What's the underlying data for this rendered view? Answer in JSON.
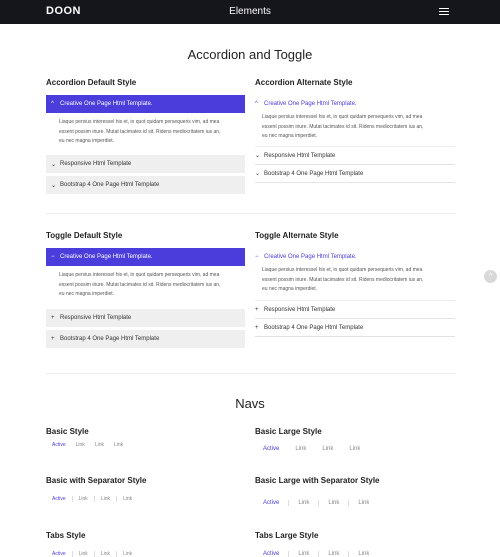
{
  "topbar": {
    "logo": "DOON",
    "title": "Elements"
  },
  "accordion_section": {
    "title": "Accordion and Toggle",
    "default": {
      "title": "Accordion Default Style",
      "items": [
        {
          "label": "Creative One Page Html Template.",
          "icon": "^"
        },
        {
          "label": "Responsive Html Template",
          "icon": "⌄"
        },
        {
          "label": "Bootstrap 4 One Page Html Template",
          "icon": "⌄"
        }
      ]
    },
    "alternate": {
      "title": "Accordion Alternate Style",
      "items": [
        {
          "label": "Creative One Page Html Template.",
          "icon": "^"
        },
        {
          "label": "Responsive Html Template",
          "icon": "⌄"
        },
        {
          "label": "Bootstrap 4 One Page Html Template",
          "icon": "⌄"
        }
      ]
    },
    "body_lines": [
      "Liaque persius interessel his et, in quot quidam persequeris vim, ad mea",
      "essent possim iriure. Mutat tacimates id sit. Ridens mediocritatem ius an,",
      "eu nec magna imperdiet."
    ]
  },
  "toggle_section": {
    "default": {
      "title": "Toggle Default Style",
      "items": [
        {
          "label": "Creative One Page Html Template.",
          "icon": "−"
        },
        {
          "label": "Responsive Html Template",
          "icon": "+"
        },
        {
          "label": "Bootstrap 4 One Page Html Template",
          "icon": "+"
        }
      ]
    },
    "alternate": {
      "title": "Toggle Alternate Style",
      "items": [
        {
          "label": "Creative One Page Html Template.",
          "icon": "−"
        },
        {
          "label": "Responsive Html Template",
          "icon": "+"
        },
        {
          "label": "Bootstrap 4 One Page Html Template",
          "icon": "+"
        }
      ]
    }
  },
  "navs_section": {
    "title": "Navs",
    "basic": {
      "title": "Basic Style",
      "links": [
        "Active",
        "Link",
        "Link",
        "Link"
      ]
    },
    "basic_large": {
      "title": "Basic Large Style",
      "links": [
        "Active",
        "Link",
        "Link",
        "Link"
      ]
    },
    "basic_sep": {
      "title": "Basic with Separator Style",
      "links": [
        "Active",
        "Link",
        "Link",
        "Link"
      ]
    },
    "basic_large_sep": {
      "title": "Basic Large with Separator Style",
      "links": [
        "Active",
        "Link",
        "Link",
        "Link"
      ]
    },
    "tabs": {
      "title": "Tabs Style",
      "links": [
        "Active",
        "Link",
        "Link",
        "Link"
      ]
    },
    "tabs_large": {
      "title": "Tabs Large Style",
      "links": [
        "Active",
        "Link",
        "Link",
        "Link"
      ]
    }
  },
  "colors": {
    "accent": "#4a3ddb",
    "topbar": "#15151c"
  }
}
